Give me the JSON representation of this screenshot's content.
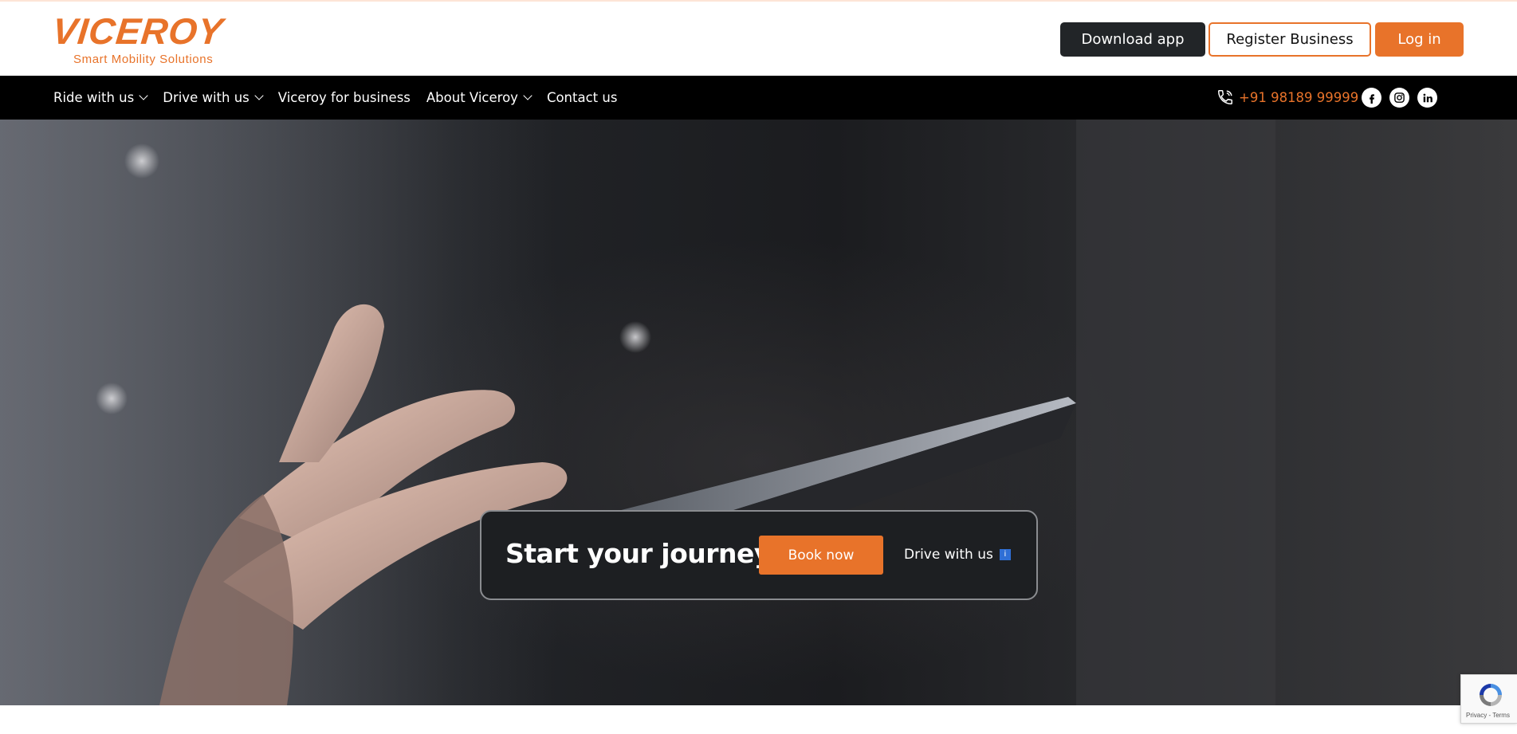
{
  "header": {
    "logo_text": "VICEROY",
    "tagline": "Smart  Mobility  Solutions",
    "download_label": "Download app",
    "register_label": "Register Business",
    "login_label": "Log in"
  },
  "nav": {
    "items": [
      {
        "label": "Ride with us",
        "has_dropdown": true
      },
      {
        "label": "Drive with us",
        "has_dropdown": true
      },
      {
        "label": "Viceroy for business",
        "has_dropdown": false
      },
      {
        "label": "About Viceroy",
        "has_dropdown": true
      },
      {
        "label": "Contact us",
        "has_dropdown": false
      }
    ],
    "phone": "+91 98189 99999",
    "socials": [
      "facebook-icon",
      "instagram-icon",
      "linkedin-icon"
    ]
  },
  "hero": {
    "cta_title": "Start your journey",
    "book_label": "Book now",
    "drive_label": "Drive with us",
    "info_glyph": "i"
  },
  "recaptcha": {
    "text": "Privacy - Terms"
  },
  "colors": {
    "brand_orange": "#e8732a",
    "dark_button": "#222528",
    "nav_background": "#000000"
  }
}
